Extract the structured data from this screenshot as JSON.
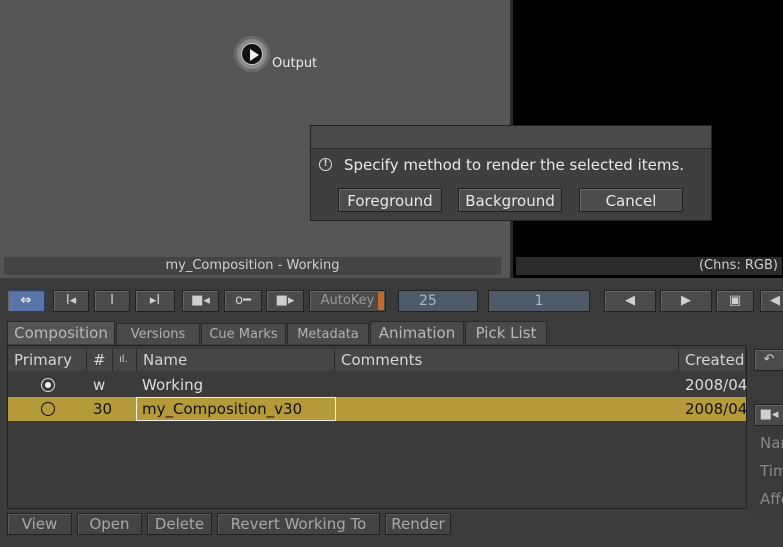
{
  "schematic": {
    "node_label": "Output",
    "status": "my_Composition - Working"
  },
  "viewer": {
    "status": "(Chns: RGB)"
  },
  "dialog": {
    "message": "Specify method to render the selected items.",
    "buttons": {
      "foreground": "Foreground",
      "background": "Background",
      "cancel": "Cancel"
    }
  },
  "toolbar": {
    "go_start": "I◂",
    "mark_in": "I",
    "go_end": "▸I",
    "autokey": "AutoKey",
    "frame": "25",
    "frame_step": "1"
  },
  "tabs": {
    "composition": "Composition",
    "versions": "Versions",
    "cue_marks": "Cue Marks",
    "metadata": "Metadata",
    "animation": "Animation",
    "pick_list": "Pick List"
  },
  "table": {
    "headers": {
      "primary": "Primary",
      "number": "#",
      "name": "Name",
      "comments": "Comments",
      "created": "Created"
    },
    "rows": [
      {
        "number": "w",
        "name": "Working",
        "comments": "",
        "created": "2008/04"
      },
      {
        "number": "30",
        "name": "my_Composition_v30",
        "comments": "",
        "created": "2008/04"
      }
    ]
  },
  "side_labels": [
    "Nar",
    "Tim",
    "Affe"
  ],
  "bottom_buttons": {
    "view": "View",
    "open": "Open",
    "delete": "Delete",
    "revert": "Revert Working To",
    "render": "Render"
  },
  "colors": {
    "selection": "#b59a3a",
    "active_button": "#5a76a8",
    "autokey_flag": "#c06a2a"
  }
}
